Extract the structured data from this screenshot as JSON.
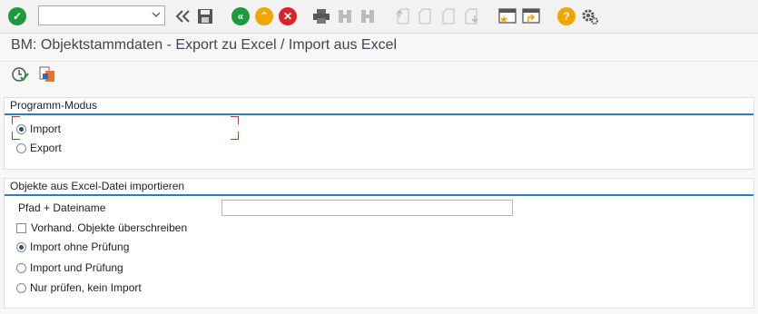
{
  "toolbar": {
    "command_field": {
      "value": "",
      "placeholder": ""
    },
    "icons": [
      "enter-icon",
      "history-icon",
      "save-icon",
      "back-icon",
      "exit-icon",
      "cancel-icon",
      "print-icon",
      "find-icon",
      "find-next-icon",
      "first-page-icon",
      "previous-page-icon",
      "next-page-icon",
      "last-page-icon",
      "new-session-icon",
      "create-shortcut-icon",
      "help-icon",
      "settings-icon"
    ],
    "colors": {
      "enter": "#1e9a3c",
      "back": "#1e9a3c",
      "exit": "#f0a500",
      "cancel": "#d6262b",
      "help": "#f0a500"
    }
  },
  "title": "BM: Objektstammdaten - Export zu Excel / Import aus Excel",
  "app_toolbar": {
    "icons": [
      "execute-icon",
      "variant-icon"
    ]
  },
  "programm_modus": {
    "title": "Programm-Modus",
    "options": [
      {
        "label": "Import",
        "selected": true
      },
      {
        "label": "Export",
        "selected": false
      }
    ]
  },
  "import_section": {
    "title": "Objekte aus Excel-Datei importieren",
    "path_label": "Pfad + Dateiname",
    "path_value": "",
    "overwrite_label": "Vorhand. Objekte überschreiben",
    "overwrite_checked": false,
    "options": [
      {
        "label": "Import ohne Prüfung",
        "selected": true
      },
      {
        "label": "Import und Prüfung",
        "selected": false
      },
      {
        "label": "Nur prüfen, kein Import",
        "selected": false
      }
    ]
  },
  "accent_color": "#2b7fc1"
}
